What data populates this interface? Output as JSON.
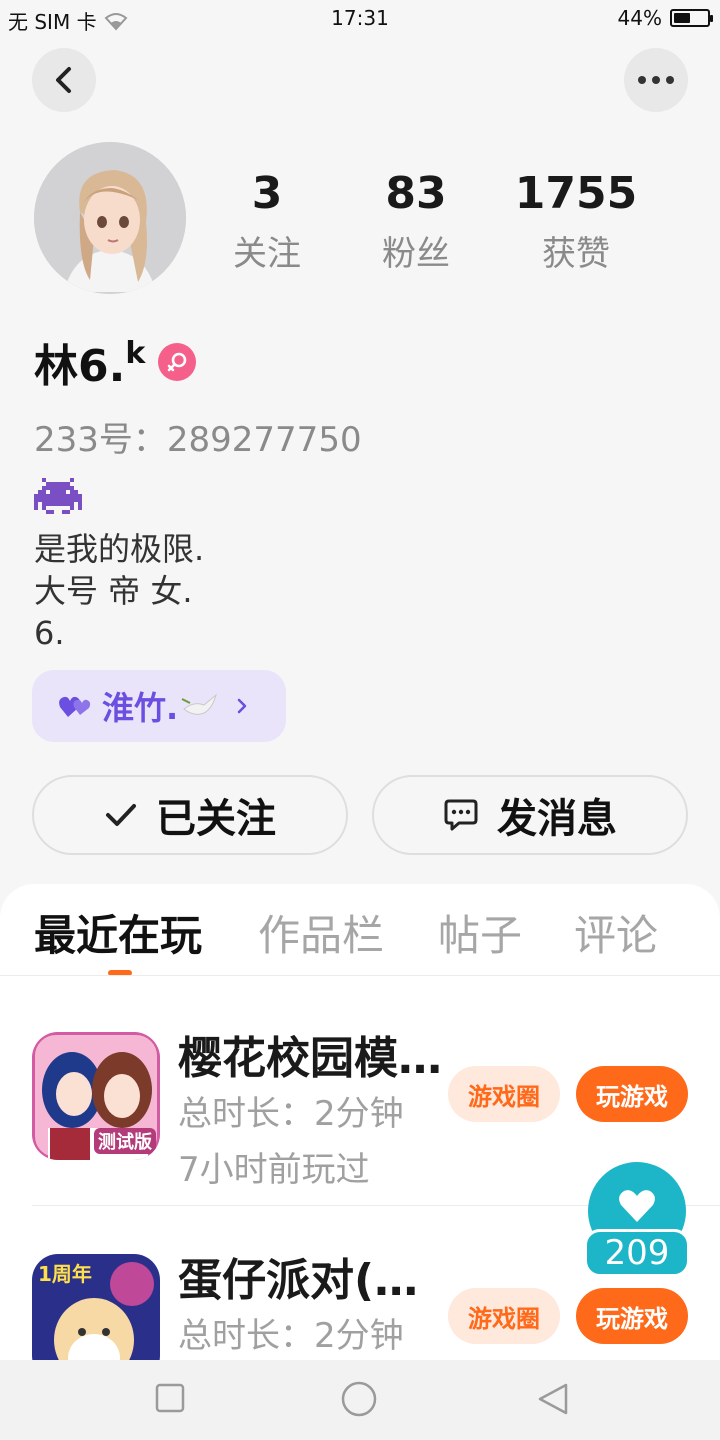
{
  "status_bar": {
    "carrier": "无 SIM 卡",
    "time": "17:31",
    "battery_percent_text": "44%",
    "battery_level": 0.44
  },
  "header": {
    "back_icon": "chevron-left-icon",
    "more_icon": "more-dots-icon"
  },
  "profile": {
    "stats": [
      {
        "value": "3",
        "label": "关注"
      },
      {
        "value": "83",
        "label": "粉丝"
      },
      {
        "value": "1755",
        "label": "获赞"
      }
    ],
    "name": "林6.",
    "name_sup": "k",
    "gender": "female",
    "uid": "233号：289277750",
    "bio_lines": [
      "是我的极限.",
      "大号 帝 女.",
      "6."
    ],
    "club_name": "淮竹.",
    "club_color": "#6a4fe0"
  },
  "actions": {
    "following_label": "已关注",
    "message_label": "发消息"
  },
  "tabs": [
    {
      "label": "最近在玩",
      "active": true
    },
    {
      "label": "作品栏",
      "active": false
    },
    {
      "label": "帖子",
      "active": false
    },
    {
      "label": "评论",
      "active": false
    }
  ],
  "games": [
    {
      "title": "樱花校园模…",
      "duration": "总时长：2分钟",
      "last_played": "7小时前玩过",
      "icon_badge": "测试版",
      "circle_label": "游戏圈",
      "play_label": "玩游戏"
    },
    {
      "title": "蛋仔派对(…",
      "duration": "总时长：2分钟",
      "icon_badge": "1周年",
      "circle_label": "游戏圈",
      "play_label": "玩游戏"
    }
  ],
  "like": {
    "count": "209"
  },
  "colors": {
    "accent": "#ff6a1a",
    "teal": "#1db6c8",
    "gender_pink": "#f5608b"
  }
}
